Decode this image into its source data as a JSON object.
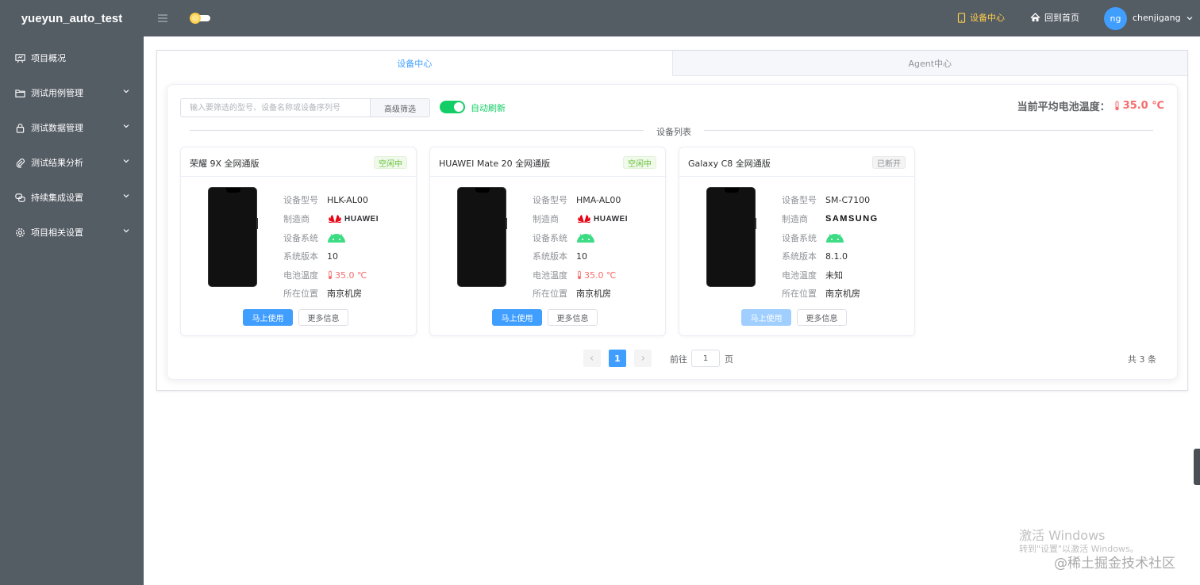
{
  "app": {
    "brand": "yueyun_auto_test"
  },
  "sidebar": {
    "items": [
      {
        "label": "项目概况",
        "icon": "chart-board-icon",
        "has_children": false
      },
      {
        "label": "测试用例管理",
        "icon": "folder-open-icon",
        "has_children": true
      },
      {
        "label": "测试数据管理",
        "icon": "lock-icon",
        "has_children": true
      },
      {
        "label": "测试结果分析",
        "icon": "paperclip-icon",
        "has_children": true
      },
      {
        "label": "持续集成设置",
        "icon": "chat-icon",
        "has_children": true
      },
      {
        "label": "项目相关设置",
        "icon": "gear-icon",
        "has_children": true
      }
    ]
  },
  "header": {
    "device_center": "设备中心",
    "home": "回到首页",
    "avatar_initials": "ng",
    "username": "chenjigang",
    "accent_color": "#ffd04b"
  },
  "tabs": [
    {
      "label": "设备中心",
      "active": true
    },
    {
      "label": "Agent中心",
      "active": false
    }
  ],
  "toolbar": {
    "search_placeholder": "输入要筛选的型号、设备名称或设备序列号",
    "search_value": "",
    "advanced_filter": "高级筛选",
    "auto_refresh_label": "自动刷新",
    "auto_refresh_on": true,
    "avg_temp_label": "当前平均电池温度：",
    "avg_temp_value": "35.0 ℃"
  },
  "device_list": {
    "title": "设备列表",
    "spec_labels": {
      "model": "设备型号",
      "maker": "制造商",
      "os": "设备系统",
      "version": "系统版本",
      "temperature": "电池温度",
      "location": "所在位置"
    },
    "devices": [
      {
        "name": "荣耀 9X 全网通版",
        "status": "空闲中",
        "model": "HLK-AL00",
        "maker": "HUAWEI",
        "os": "android",
        "version": "10",
        "temperature": "35.0 ℃",
        "location": "南京机房",
        "use_btn": "马上使用",
        "use_enabled": true,
        "more_btn": "更多信息"
      },
      {
        "name": "HUAWEI Mate 20 全网通版",
        "status": "空闲中",
        "model": "HMA-AL00",
        "maker": "HUAWEI",
        "os": "android",
        "version": "10",
        "temperature": "35.0 ℃",
        "location": "南京机房",
        "use_btn": "马上使用",
        "use_enabled": true,
        "more_btn": "更多信息"
      },
      {
        "name": "Galaxy C8 全网通版",
        "status": "已断开",
        "model": "SM-C7100",
        "maker": "SAMSUNG",
        "os": "android",
        "version": "8.1.0",
        "temperature": "未知",
        "location": "南京机房",
        "use_btn": "马上使用",
        "use_enabled": false,
        "more_btn": "更多信息"
      }
    ]
  },
  "pagination": {
    "current_page": "1",
    "goto_label": "前往",
    "goto_value": "1",
    "page_unit": "页",
    "total": "共 3 条"
  },
  "watermark": {
    "line1": "激活 Windows",
    "line2": "转到\"设置\"以激活 Windows。",
    "site": "@稀土掘金技术社区"
  }
}
